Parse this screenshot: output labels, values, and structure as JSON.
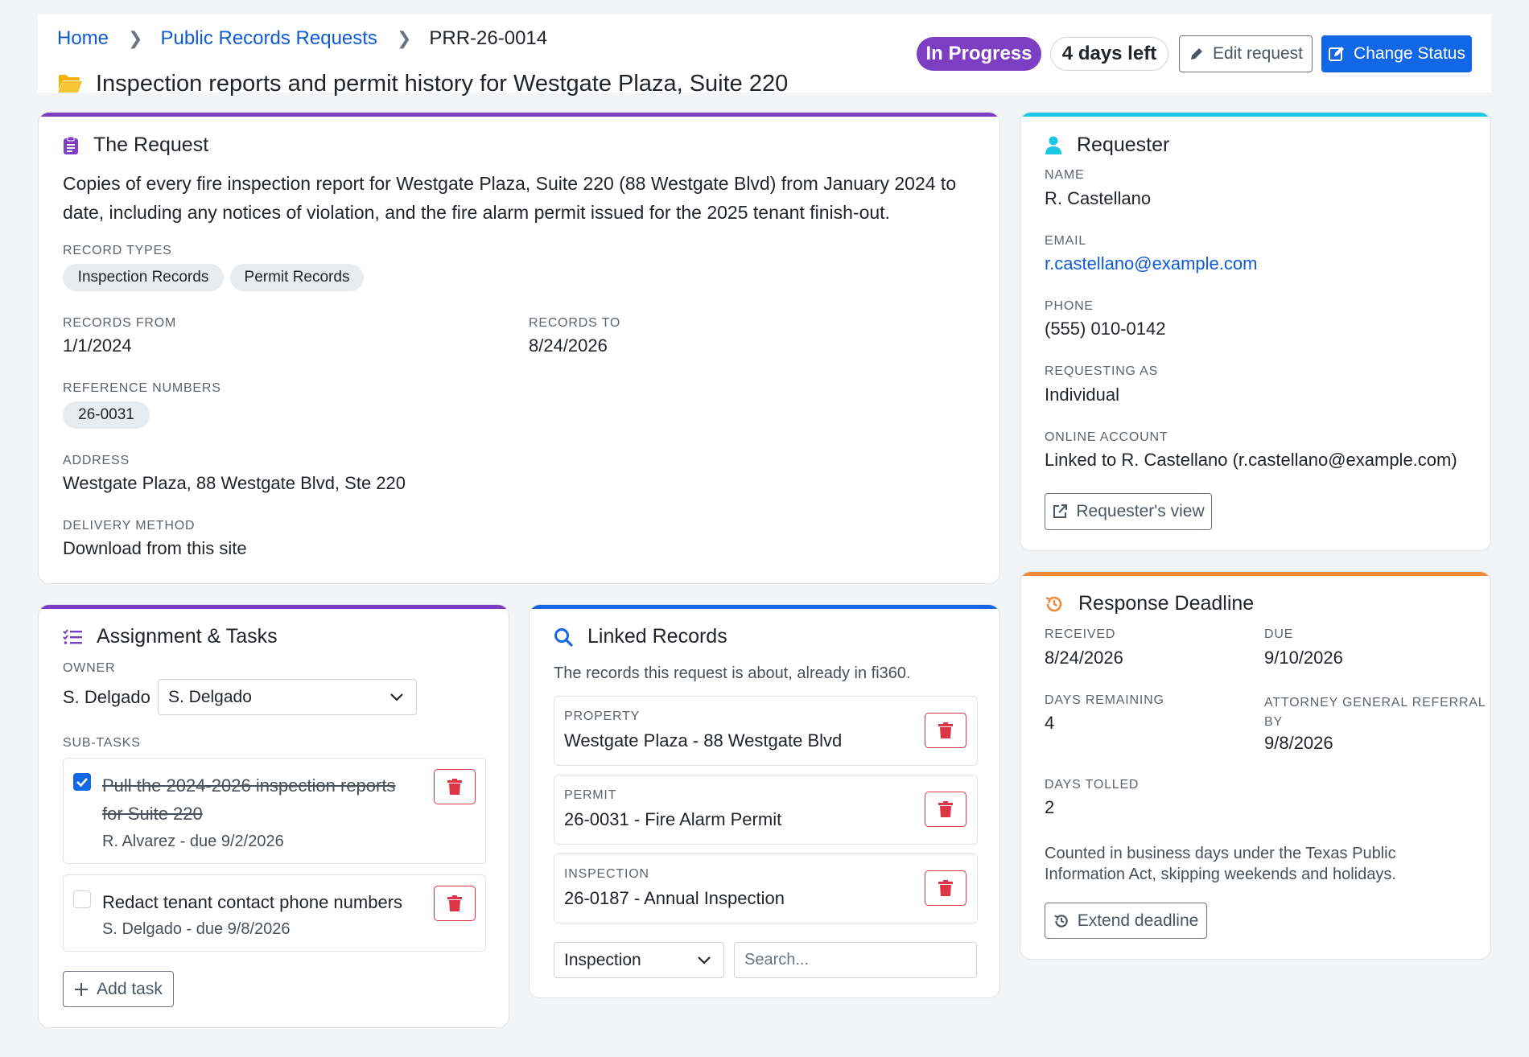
{
  "breadcrumb": {
    "home": "Home",
    "section": "Public Records Requests",
    "current": "PRR-26-0014"
  },
  "page_title": "Inspection reports and permit history for Westgate Plaza, Suite 220",
  "status": {
    "label": "In Progress",
    "days_left": "4 days left"
  },
  "actions": {
    "edit": "Edit request",
    "change_status": "Change Status"
  },
  "colors": {
    "purple": "#7c3fc3",
    "primary": "#1267e6",
    "cyan": "#1ec6e6",
    "orange": "#f2883a",
    "danger": "#dc3545"
  },
  "request": {
    "heading": "The Request",
    "description_line1": "Copies of every fire inspection report for Westgate Plaza, Suite 220 (88 Westgate Blvd) from January 2024 to",
    "description_line2": "date, including any notices of violation, and the fire alarm permit issued for the 2025 tenant finish-out.",
    "record_types_label": "Record Types",
    "record_types": [
      "Inspection Records",
      "Permit Records"
    ],
    "records_from_label": "Records From",
    "records_from": "1/1/2024",
    "records_to_label": "Records To",
    "records_to": "8/24/2026",
    "reference_numbers_label": "Reference Numbers",
    "reference_numbers": [
      "26-0031"
    ],
    "address_label": "Address",
    "address": "Westgate Plaza, 88 Westgate Blvd, Ste 220",
    "delivery_label": "Delivery Method",
    "delivery": "Download from this site"
  },
  "requester": {
    "heading": "Requester",
    "name_label": "Name",
    "name": "R. Castellano",
    "email_label": "Email",
    "email": "r.castellano@example.com",
    "phone_label": "Phone",
    "phone": "(555) 010-0142",
    "requesting_as_label": "Requesting As",
    "requesting_as": "Individual",
    "account_label": "Online Account",
    "account": "Linked to R. Castellano (r.castellano@example.com)",
    "view_button": "Requester's view"
  },
  "tasks": {
    "heading": "Assignment & Tasks",
    "owner_label": "Owner",
    "owner": "S. Delgado",
    "owner_select": "S. Delgado",
    "subtasks_label": "Sub-Tasks",
    "items": [
      {
        "line1": "Pull the 2024-2026 inspection reports",
        "line2": "for Suite 220",
        "meta": "R. Alvarez - due 9/2/2026",
        "done": true
      },
      {
        "line1": "Redact tenant contact phone numbers",
        "line2": "",
        "meta": "S. Delgado - due 9/8/2026",
        "done": false
      }
    ],
    "add_button": "Add task"
  },
  "linked": {
    "heading": "Linked Records",
    "subtitle": "The records this request is about, already in fi360.",
    "items": [
      {
        "type": "Property",
        "value": "Westgate Plaza - 88 Westgate Blvd"
      },
      {
        "type": "Permit",
        "value": "26-0031 - Fire Alarm Permit"
      },
      {
        "type": "Inspection",
        "value": "26-0187 - Annual Inspection"
      }
    ],
    "type_select": "Inspection",
    "search_placeholder": "Search..."
  },
  "deadline": {
    "heading": "Response Deadline",
    "received_label": "Received",
    "received": "8/24/2026",
    "due_label": "Due",
    "due": "9/10/2026",
    "remaining_label": "Days Remaining",
    "remaining": "4",
    "ag_label_line1": "Attorney General Referral",
    "ag_label_line2": "By",
    "ag": "9/8/2026",
    "tolled_label": "Days Tolled",
    "tolled": "2",
    "note_line1": "Counted in business days under the Texas Public",
    "note_line2": "Information Act, skipping weekends and holidays.",
    "extend_button": "Extend deadline"
  }
}
